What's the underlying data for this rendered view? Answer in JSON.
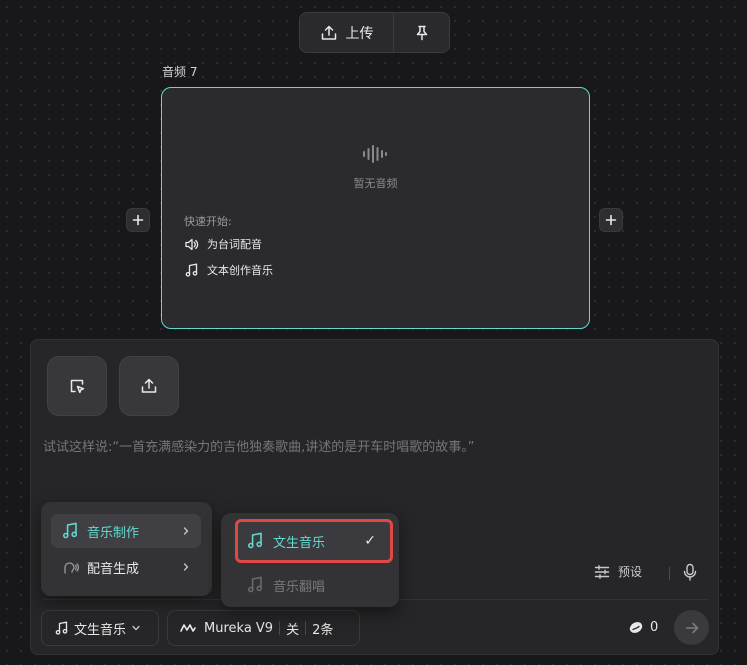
{
  "toolbar": {
    "upload_label": "上传"
  },
  "node": {
    "title": "音频 7",
    "empty_text": "暂无音频",
    "quick_start_title": "快速开始:",
    "quick_items": [
      {
        "label": "为台词配音",
        "icon": "speaker-icon"
      },
      {
        "label": "文本创作音乐",
        "icon": "music-note-icon"
      }
    ]
  },
  "composer": {
    "placeholder": "试试这样说:“一首充满感染力的吉他独奏歌曲,讲述的是开车时唱歌的故事。”",
    "preset_label": "预设",
    "mode_label": "文生音乐",
    "model_name": "Mureka V9",
    "model_toggle": "关",
    "count_label": "2条",
    "credits": "0"
  },
  "menu_category": {
    "items": [
      {
        "label": "音乐制作",
        "active": true,
        "icon": "music-note-icon"
      },
      {
        "label": "配音生成",
        "active": false,
        "icon": "voice-icon"
      }
    ]
  },
  "menu_music": {
    "items": [
      {
        "label": "文生音乐",
        "selected": true,
        "check": "✓"
      },
      {
        "label": "音乐翻唱",
        "selected": false
      }
    ]
  },
  "colors": {
    "accent_teal": "#62d8cf",
    "highlight_red": "#e04848",
    "background": "#18181a"
  }
}
